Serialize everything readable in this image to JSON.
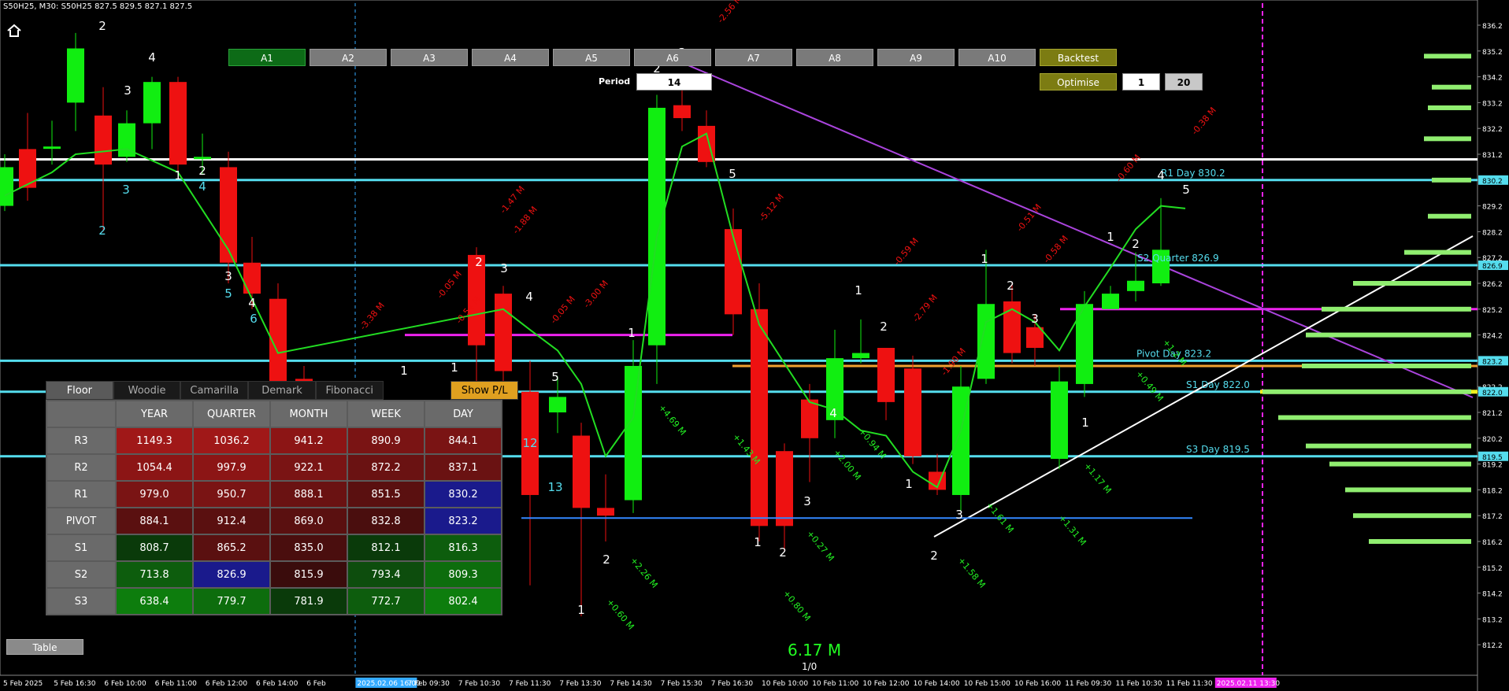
{
  "header": {
    "symbol_line": "S50H25, M30:  S50H25  827.5 829.5 827.1 827.5"
  },
  "buttons": {
    "tabs": [
      "A1",
      "A2",
      "A3",
      "A4",
      "A5",
      "A6",
      "A7",
      "A8",
      "A9",
      "A10"
    ],
    "backtest": "Backtest",
    "optimise": "Optimise",
    "period_label": "Period",
    "period_value": "14",
    "opt_from": "1",
    "opt_to": "20"
  },
  "colors": {
    "bull": "#11ee11",
    "bear": "#ee1111",
    "cyan": "#55ddee",
    "magenta": "#ee22ee",
    "purple": "#aa44dd",
    "orange": "#f0a030"
  },
  "price_axis": [
    "836.2",
    "835.2",
    "834.2",
    "833.2",
    "832.2",
    "831.2",
    "830.2",
    "829.2",
    "828.2",
    "827.2",
    "826.9",
    "826.2",
    "825.2",
    "824.2",
    "823.2",
    "822.2",
    "822.0",
    "821.2",
    "820.2",
    "819.5",
    "819.2",
    "818.2",
    "817.2",
    "816.2",
    "815.2",
    "814.2",
    "813.2",
    "812.2"
  ],
  "time_axis": [
    "5 Feb 2025",
    "5 Feb 16:30",
    "6 Feb 10:00",
    "6 Feb 11:00",
    "6 Feb 12:00",
    "6 Feb 14:00",
    "6 Feb",
    "2025.02.06 16:00",
    "7 Feb 09:30",
    "7 Feb 10:30",
    "7 Feb 11:30",
    "7 Feb 13:30",
    "7 Feb 14:30",
    "7 Feb 15:30",
    "7 Feb 16:30",
    "10 Feb 10:00",
    "10 Feb 11:00",
    "10 Feb 12:00",
    "10 Feb 14:00",
    "10 Feb 15:00",
    "10 Feb 16:00",
    "11 Feb 09:30",
    "11 Feb 10:30",
    "11 Feb 11:30",
    "2025.02.11 13:30"
  ],
  "level_labels": {
    "r1_day": "R1 Day 830.2",
    "s2_quarter": "S2 Quarter 826.9",
    "pivot_day": "Pivot Day 823.2",
    "s1_day": "S1 Day 822.0",
    "s3_day": "S3 Day 819.5"
  },
  "pivot_table": {
    "tabs": [
      "Floor",
      "Woodie",
      "Camarilla",
      "Demark",
      "Fibonacci"
    ],
    "show_pl": "Show P/L",
    "columns": [
      "YEAR",
      "QUARTER",
      "MONTH",
      "WEEK",
      "DAY"
    ],
    "rows": [
      {
        "name": "R3",
        "values": [
          "1149.3",
          "1036.2",
          "941.2",
          "890.9",
          "844.1"
        ]
      },
      {
        "name": "R2",
        "values": [
          "1054.4",
          "997.9",
          "922.1",
          "872.2",
          "837.1"
        ]
      },
      {
        "name": "R1",
        "values": [
          "979.0",
          "950.7",
          "888.1",
          "851.5",
          "830.2"
        ]
      },
      {
        "name": "PIVOT",
        "values": [
          "884.1",
          "912.4",
          "869.0",
          "832.8",
          "823.2"
        ]
      },
      {
        "name": "S1",
        "values": [
          "808.7",
          "865.2",
          "835.0",
          "812.1",
          "816.3"
        ]
      },
      {
        "name": "S2",
        "values": [
          "713.8",
          "826.9",
          "815.9",
          "793.4",
          "809.3"
        ]
      },
      {
        "name": "S3",
        "values": [
          "638.4",
          "779.7",
          "781.9",
          "772.7",
          "802.4"
        ]
      }
    ],
    "table_button": "Table"
  },
  "footer": {
    "volume": "6.17 M",
    "ratio": "1/0"
  },
  "annotations_red": [
    "-1.47 M",
    "-1.88 M",
    "-0.05 M",
    "-0.54 M",
    "-0.05 M",
    "-3.00 M",
    "-3.38 M",
    "-5.12 M",
    "-2.56 M",
    "-0.59 M",
    "-2.79 M",
    "-1.90 M",
    "-0.51 M",
    "-0.58 M",
    "-0.60 M",
    "-0.38 M"
  ],
  "annotations_green": [
    "+4.69 M",
    "+1.43 M",
    "+2.00 M",
    "+0.94 M",
    "+2.26 M",
    "+0.60 M",
    "+0.80 M",
    "+0.27 M",
    "+1.58 M",
    "+1.61 M",
    "+1.31 M",
    "+1.17 M",
    "+0.49 M",
    "+1.2 M"
  ]
}
